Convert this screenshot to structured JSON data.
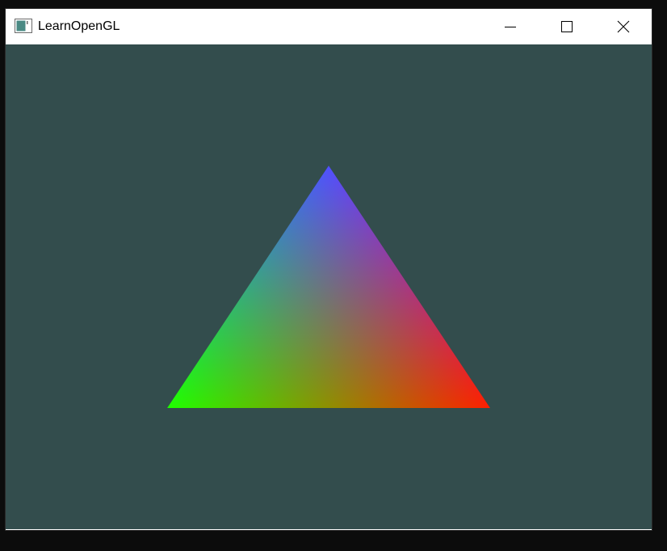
{
  "window": {
    "title": "LearnOpenGL",
    "controls": {
      "minimize": "minimize-icon",
      "maximize": "maximize-icon",
      "close": "close-icon"
    }
  },
  "scene": {
    "clear_color": "#334d4d",
    "triangle": {
      "vertices": [
        {
          "name": "bottom-right",
          "color": "#ff0000"
        },
        {
          "name": "bottom-left",
          "color": "#00ff00"
        },
        {
          "name": "top",
          "color": "#0000ff"
        }
      ]
    }
  }
}
